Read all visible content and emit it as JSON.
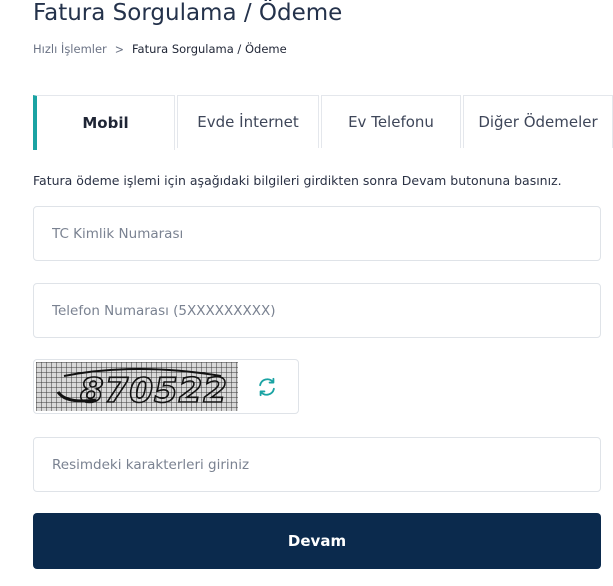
{
  "header": {
    "title": "Fatura Sorgulama / Ödeme"
  },
  "breadcrumb": {
    "items": [
      "Hızlı İşlemler",
      "Fatura Sorgulama / Ödeme"
    ],
    "separator": ">"
  },
  "tabs": [
    {
      "label": "Mobil",
      "active": true
    },
    {
      "label": "Evde İnternet",
      "active": false
    },
    {
      "label": "Ev Telefonu",
      "active": false
    },
    {
      "label": "Diğer Ödemeler",
      "active": false
    }
  ],
  "form": {
    "instructions": "Fatura ödeme işlemi için aşağıdaki bilgileri girdikten sonra Devam butonuna basınız.",
    "tc_field": {
      "placeholder": "TC Kimlik Numarası",
      "value": ""
    },
    "phone_field": {
      "placeholder": "Telefon Numarası (5XXXXXXXXX)",
      "value": ""
    },
    "captcha": {
      "text": "870522",
      "refresh_icon": "refresh-icon"
    },
    "captcha_field": {
      "placeholder": "Resimdeki karakterleri giriniz",
      "value": ""
    },
    "submit_label": "Devam"
  },
  "colors": {
    "accent": "#1aa3a3",
    "primary_button": "#0b2a4d",
    "title_text": "#24324b",
    "border": "#dfe3e8"
  }
}
